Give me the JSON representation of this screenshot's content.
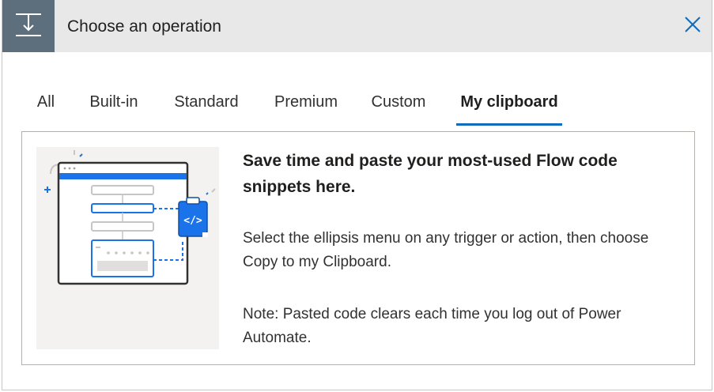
{
  "header": {
    "title": "Choose an operation",
    "icon": "insert-step-icon",
    "close_icon": "close-icon"
  },
  "tabs": [
    {
      "label": "All",
      "active": false
    },
    {
      "label": "Built-in",
      "active": false
    },
    {
      "label": "Standard",
      "active": false
    },
    {
      "label": "Premium",
      "active": false
    },
    {
      "label": "Custom",
      "active": false
    },
    {
      "label": "My clipboard",
      "active": true
    }
  ],
  "clipboard_panel": {
    "illustration_icon": "clipboard-code-illustration",
    "heading": "Save time and paste your most-used Flow code snippets here.",
    "instruction": "Select the ellipsis menu on any trigger or action, then choose Copy to my Clipboard.",
    "note": "Note: Pasted code clears each time you log out of Power Automate."
  },
  "colors": {
    "accent": "#0f6cbd",
    "illustration_blue": "#1a73e8",
    "header_bg": "#e8e8e8",
    "header_icon_bg": "#5d6e7d"
  }
}
